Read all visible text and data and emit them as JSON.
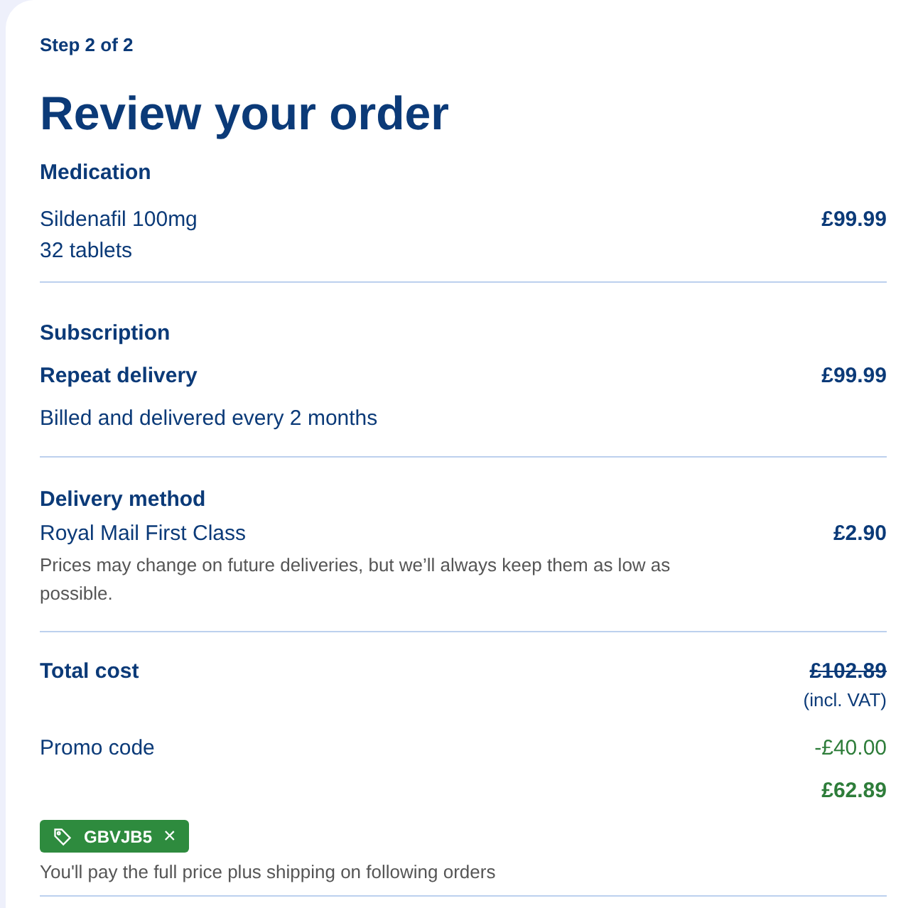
{
  "step": "Step 2 of 2",
  "title": "Review your order",
  "medication": {
    "heading": "Medication",
    "name": "Sildenafil 100mg",
    "quantity": "32 tablets",
    "price": "£99.99"
  },
  "subscription": {
    "heading": "Subscription",
    "plan": "Repeat delivery",
    "price": "£99.99",
    "note": "Billed and delivered every 2 months"
  },
  "delivery": {
    "heading": "Delivery method",
    "method": "Royal Mail First Class",
    "price": "£2.90",
    "note": "Prices may change on future deliveries, but we’ll always keep them as low as possible."
  },
  "total": {
    "label": "Total cost",
    "original_price": "£102.89",
    "vat_note": "(incl. VAT)",
    "promo_label": "Promo code",
    "discount": "-£40.00",
    "final_price": "£62.89",
    "promo_tag": {
      "code": "GBVJB5",
      "remove": "×"
    },
    "promo_note": "You'll pay the full price plus shipping on following orders"
  }
}
